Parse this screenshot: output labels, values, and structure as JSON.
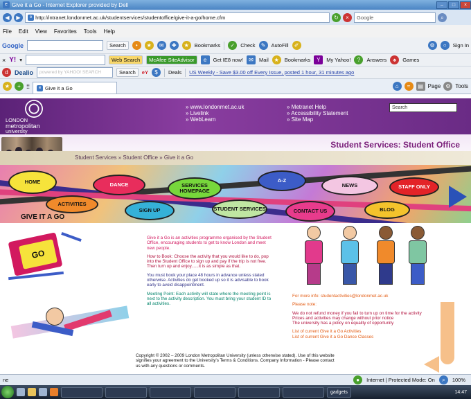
{
  "browser": {
    "title": "Give it a Go - Internet Explorer provided by Dell",
    "url": "http://intranet.londonmet.ac.uk/studentservices/studentoffice/give-it-a-go/home.cfm",
    "search_engine": "Google",
    "menu": [
      "File",
      "Edit",
      "View",
      "Favorites",
      "Tools",
      "Help"
    ],
    "google_bar": {
      "label": "Google",
      "search": "Search",
      "bookmarks": "Bookmarks",
      "check": "Check",
      "autofill": "AutoFill",
      "signin": "Sign In"
    },
    "yahoo_bar": {
      "web_search": "Web Search",
      "mcafee": "McAfee SiteAdvisor",
      "get_ie8": "Get IE8 now!",
      "mail": "Mail",
      "bookmarks": "Bookmarks",
      "my_yahoo": "My Yahoo!",
      "answers": "Answers",
      "games": "Games"
    },
    "deals_bar": {
      "dealio": "Dealio",
      "search_placeholder": "powered by YAHOO! SEARCH",
      "search": "Search",
      "deals": "Deals",
      "ticker": "US Weekly - Save $3.00 off Every Issue, posted 1 hour, 31 minutes ago"
    },
    "tab": "Give it a Go",
    "page_menu": "Page",
    "tools_menu": "Tools",
    "status": {
      "left": "ne",
      "zone": "Internet | Protected Mode: On",
      "zoom": "100%"
    },
    "taskbar": {
      "gadgets": "gadgets",
      "clock": "14:47"
    }
  },
  "site": {
    "logo": [
      "LONDON",
      "metropolitan",
      "university"
    ],
    "links_left": [
      "» www.londonmet.ac.uk",
      "» Livelink",
      "» WebLearn"
    ],
    "links_right": [
      "» Metranet Help",
      "» Accessibility Statement",
      "» Site Map"
    ],
    "search": "Search",
    "section_title": "Student Services: Student Office",
    "breadcrumb": "Student Services » Student Office » Give it a Go",
    "nav": {
      "home": "HOME",
      "dance": "DANCE",
      "services": "SERVICES HOMEPAGE",
      "az": "A-Z",
      "news": "NEWS",
      "staff": "STAFF ONLY",
      "activities": "ACTIVITIES",
      "signup": "SIGN UP",
      "student": "STUDENT SERVICES",
      "contact": "CONTACT US",
      "blog": "BLOG"
    },
    "giag_label": "GIVE IT A GO"
  },
  "content": {
    "intro": "Give it a Go is an activities programme organised by the Student Office, encouraging students to get to know London and meet new people.",
    "howto": "How to Book: Choose the activity that you would like to do, pop into the Student Office to sign up and pay if the trip is not free. Then turn up and enjoy......it is as simple as that.",
    "booking": "You must book your place 48 hours in advance unless stated otherwise. Activities do get booked up so it is advisable to book early to avoid disappointment.",
    "meeting": "Meeting Point: Each activity will state where the meeting point is next to the activity description. You must bring your student ID to all activities.",
    "copyright": "Copyright © 2002 – 2009 London Metropolitan University (unless otherwise stated). Use of this website signifies your agreement to the University's Terms & Conditions. Company Information - Please contact us with any questions or comments.",
    "more_info": "For more info: studentactivities@londonmet.ac.uk",
    "please_note": "Please note:",
    "notes": [
      "We do not refund money if you fail to turn up on time for the activity",
      "Prices and activities may change without prior notice",
      "The university has a policy on equality of opportunity"
    ],
    "lists": [
      "List of current Give it a Go Activities",
      "List of current Give it a Go Dance Classes"
    ]
  },
  "colors": {
    "purple": "#6a2b85",
    "accent": "#7a1f7a"
  }
}
